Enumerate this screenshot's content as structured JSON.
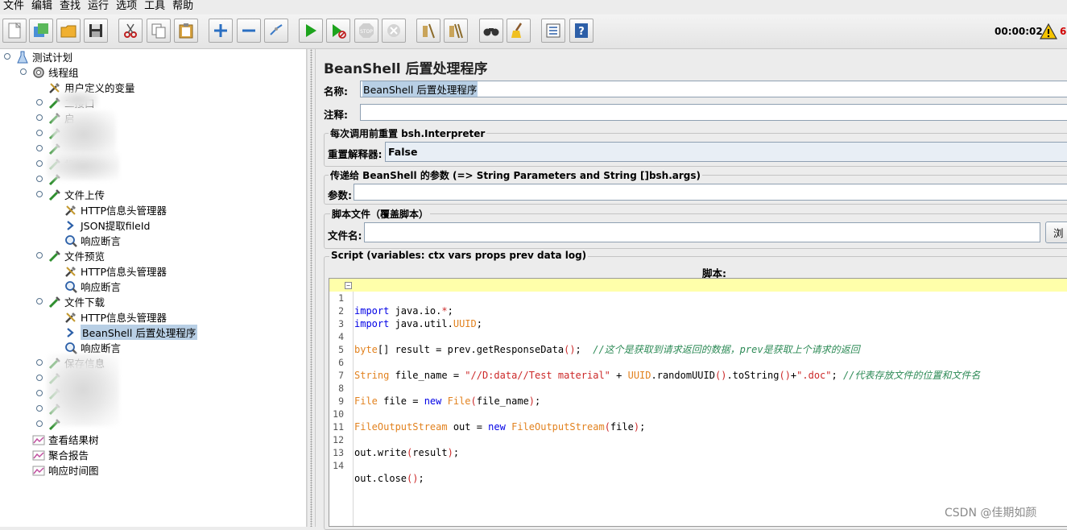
{
  "menu": [
    "文件",
    "编辑",
    "查找",
    "运行",
    "选项",
    "工具",
    "帮助"
  ],
  "toolbar": {
    "buttons": [
      {
        "name": "new-icon"
      },
      {
        "name": "templates-icon"
      },
      {
        "name": "open-icon"
      },
      {
        "name": "save-icon"
      },
      {
        "name": "cut-icon"
      },
      {
        "name": "copy-icon"
      },
      {
        "name": "paste-icon"
      },
      {
        "name": "expand-icon"
      },
      {
        "name": "collapse-icon"
      },
      {
        "name": "toggle-icon"
      },
      {
        "name": "start-icon"
      },
      {
        "name": "start-no-pause-icon"
      },
      {
        "name": "stop-icon"
      },
      {
        "name": "shutdown-icon"
      },
      {
        "name": "clear-icon"
      },
      {
        "name": "clear-all-icon"
      },
      {
        "name": "search-icon"
      },
      {
        "name": "reset-search-icon"
      },
      {
        "name": "function-helper-icon"
      },
      {
        "name": "help-icon"
      }
    ],
    "timer": "00:00:02",
    "warning_count": "6"
  },
  "tree": {
    "root": "测试计划",
    "thread_group": "线程组",
    "nodes": [
      {
        "label": "用户定义的变量",
        "icon": "wrench-icon"
      },
      {
        "label": "二接口",
        "icon": "sampler-icon"
      },
      {
        "label": "启",
        "icon": "sampler-icon"
      },
      {
        "label": "",
        "icon": "sampler-icon"
      },
      {
        "label": "",
        "icon": "sampler-icon"
      },
      {
        "label": "机关",
        "icon": "sampler-icon"
      },
      {
        "label": "",
        "icon": "sampler-icon"
      },
      {
        "label": "文件上传",
        "icon": "sampler-icon"
      },
      {
        "label": "HTTP信息头管理器",
        "icon": "wrench-icon"
      },
      {
        "label": "JSON提取fileId",
        "icon": "arrow-icon"
      },
      {
        "label": "响应断言",
        "icon": "magnifier-icon"
      },
      {
        "label": "文件预览",
        "icon": "sampler-icon"
      },
      {
        "label": "HTTP信息头管理器",
        "icon": "wrench-icon"
      },
      {
        "label": "响应断言",
        "icon": "magnifier-icon"
      },
      {
        "label": "文件下载",
        "icon": "sampler-icon"
      },
      {
        "label": "HTTP信息头管理器",
        "icon": "wrench-icon"
      },
      {
        "label": "BeanShell 后置处理程序",
        "icon": "arrow-icon"
      },
      {
        "label": "响应断言",
        "icon": "magnifier-icon"
      },
      {
        "label": "保存信息",
        "icon": "sampler-icon"
      },
      {
        "label": "",
        "icon": "sampler-icon"
      },
      {
        "label": "",
        "icon": "sampler-icon"
      },
      {
        "label": "",
        "icon": "sampler-icon"
      },
      {
        "label": "",
        "icon": "sampler-icon"
      },
      {
        "label": "查看结果树",
        "icon": "listener-icon"
      },
      {
        "label": "聚合报告",
        "icon": "listener-icon"
      },
      {
        "label": "响应时间图",
        "icon": "listener-icon"
      }
    ]
  },
  "panel": {
    "title": "BeanShell 后置处理程序",
    "name_label": "名称:",
    "name_value": "BeanShell 后置处理程序",
    "comment_label": "注释:",
    "comment_value": "",
    "reset_group_title": "每次调用前重置 bsh.Interpreter",
    "reset_label": "重置解释器:",
    "reset_value": "False",
    "params_group_title": "传递给 BeanShell 的参数 (=> String Parameters and String []bsh.args)",
    "params_label": "参数:",
    "params_value": "",
    "file_group_title": "脚本文件（覆盖脚本）",
    "file_label": "文件名:",
    "file_value": "",
    "browse_label": "浏",
    "script_group_title": "Script (variables: ctx vars props prev data log)",
    "script_label": "脚本:"
  },
  "script_lines": [
    "1",
    "2",
    "3",
    "4",
    "5",
    "6",
    "7",
    "8",
    "9",
    "10",
    "11",
    "12",
    "13",
    "14"
  ],
  "watermark": "CSDN @佳期如颜"
}
